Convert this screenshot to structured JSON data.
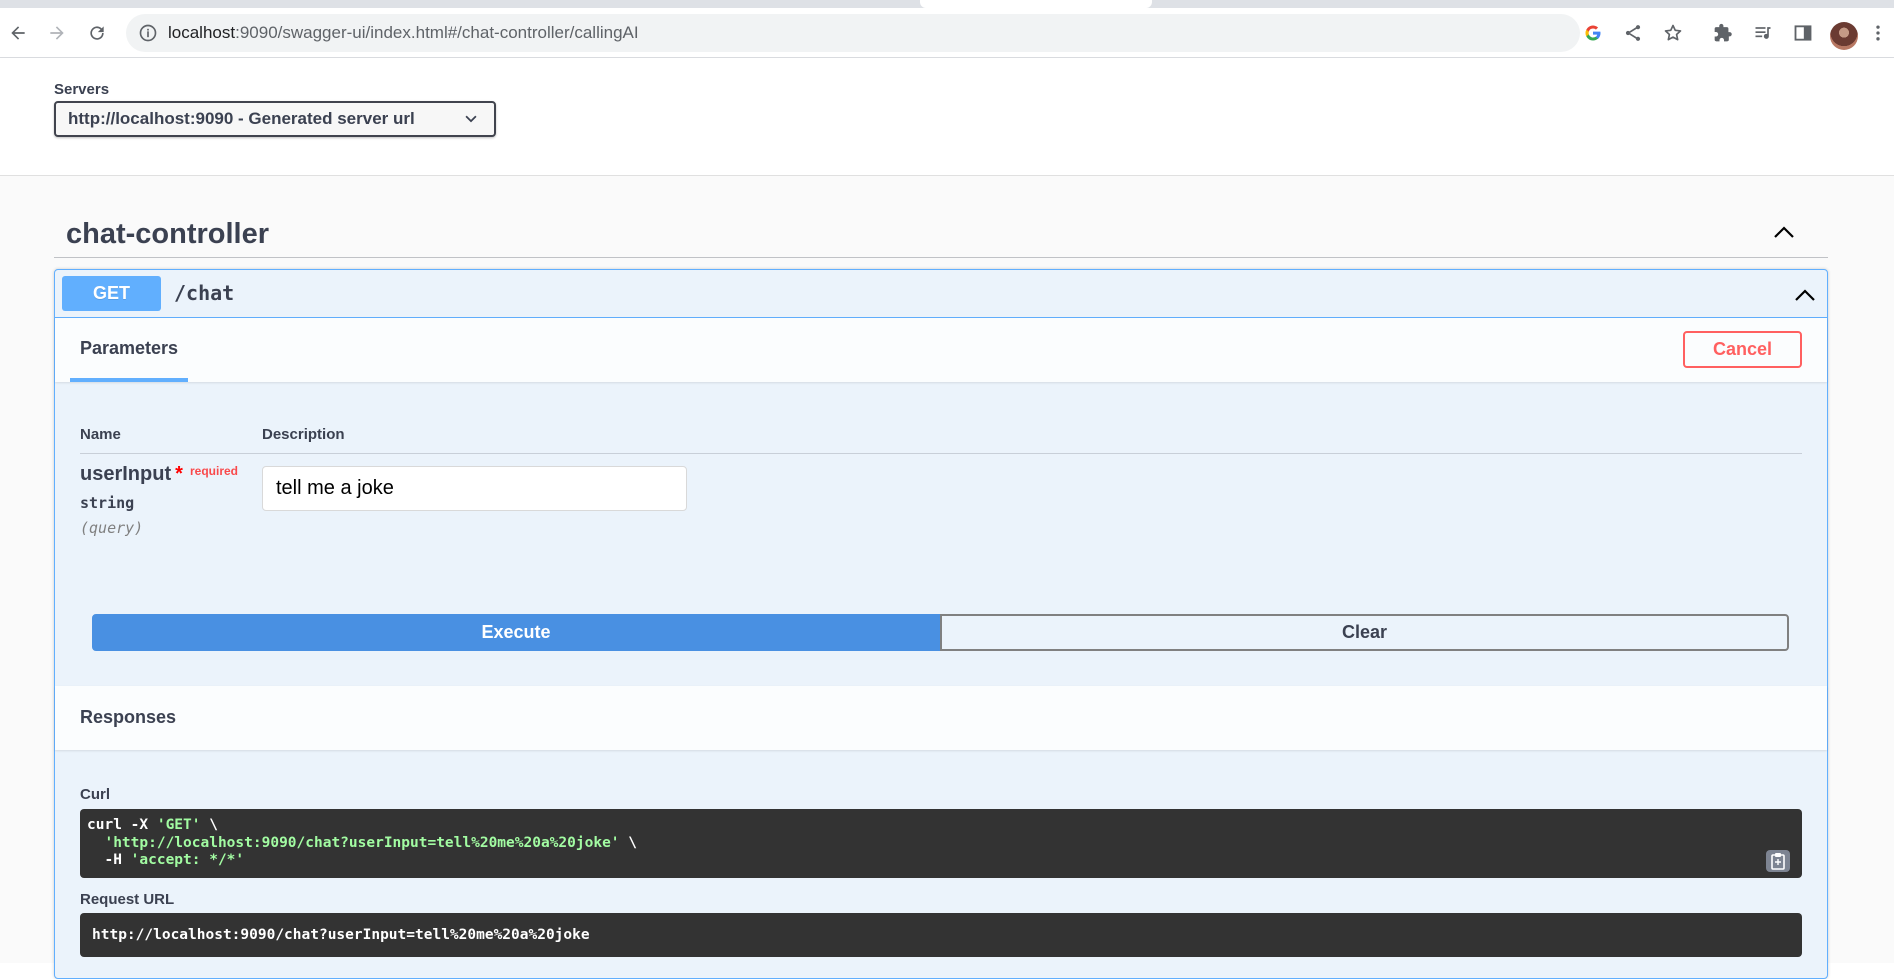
{
  "browser": {
    "url_host": "localhost",
    "url_rest": ":9090/swagger-ui/index.html#/chat-controller/callingAI"
  },
  "servers": {
    "label": "Servers",
    "selected": "http://localhost:9090 - Generated server url"
  },
  "tag": {
    "title": "chat-controller"
  },
  "operation": {
    "method": "GET",
    "path": "/chat",
    "tab_label": "Parameters",
    "cancel_label": "Cancel",
    "columns": {
      "name": "Name",
      "description": "Description"
    },
    "param": {
      "name": "userInput",
      "required_star": "*",
      "required_label": "required",
      "type": "string",
      "in": "(query)",
      "value": "tell me a joke"
    },
    "execute_label": "Execute",
    "clear_label": "Clear",
    "responses_title": "Responses",
    "curl_label": "Curl",
    "curl": {
      "l1_cmd": "curl -X ",
      "l1_str": "'GET'",
      "l1_end": " \\",
      "l2_indent": "  ",
      "l2_str": "'http://localhost:9090/chat?userInput=tell%20me%20a%20joke'",
      "l2_end": " \\",
      "l3_cmd": "  -H ",
      "l3_str": "'accept: */*'"
    },
    "request_url_label": "Request URL",
    "request_url": "http://localhost:9090/chat?userInput=tell%20me%20a%20joke"
  },
  "colors": {
    "get_accent": "#61affe",
    "execute_blue": "#4990e2",
    "cancel_red": "#ff6060",
    "code_bg": "#333333"
  }
}
